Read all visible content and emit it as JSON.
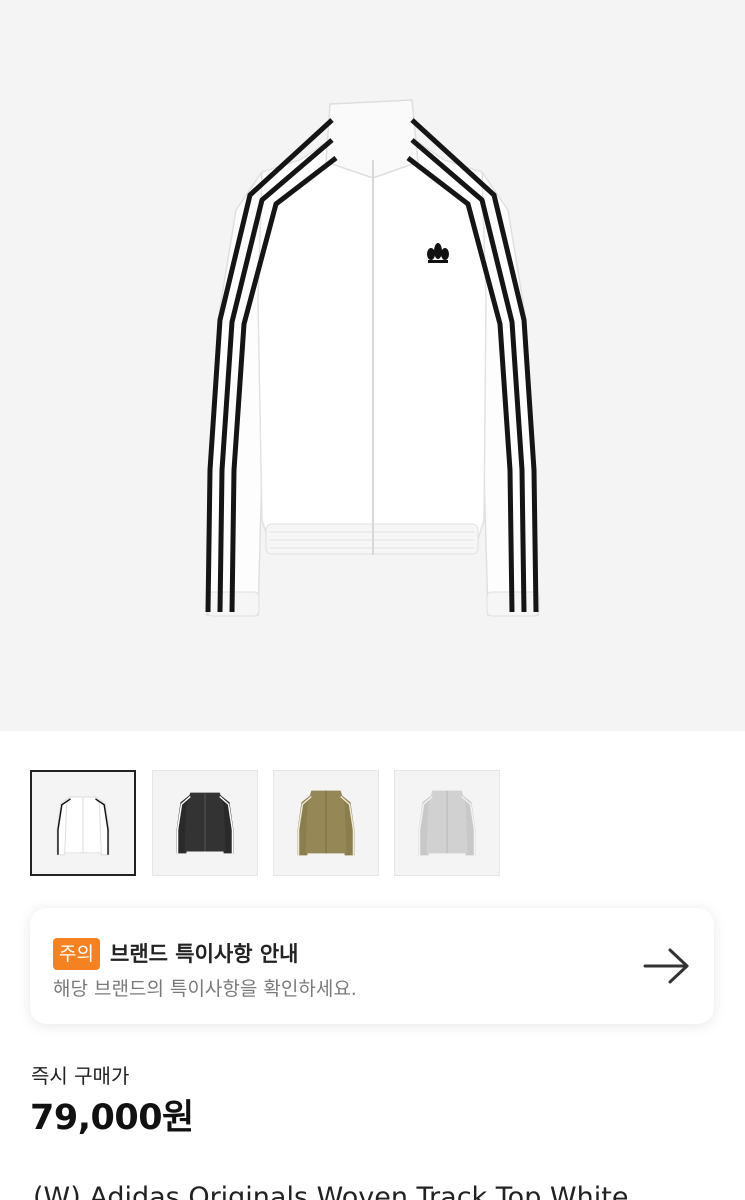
{
  "product_images": [
    {
      "color": "white",
      "icon": "jacket-white-image"
    },
    {
      "color": "black",
      "icon": "jacket-black-image"
    },
    {
      "color": "olive",
      "icon": "jacket-olive-image"
    },
    {
      "color": "grey",
      "icon": "jacket-grey-image"
    }
  ],
  "selected_image_index": 0,
  "brand_notice": {
    "badge": "주의",
    "title": "브랜드 특이사항 안내",
    "description": "해당 브랜드의 특이사항을 확인하세요.",
    "icon": "arrow-right-icon"
  },
  "pricing": {
    "label": "즉시 구매가",
    "price": "79,000원"
  },
  "product": {
    "name": "(W) Adidas Originals Woven Track Top White"
  },
  "colors": {
    "badge": "#f58220",
    "hero_background": "#f4f4f4"
  }
}
